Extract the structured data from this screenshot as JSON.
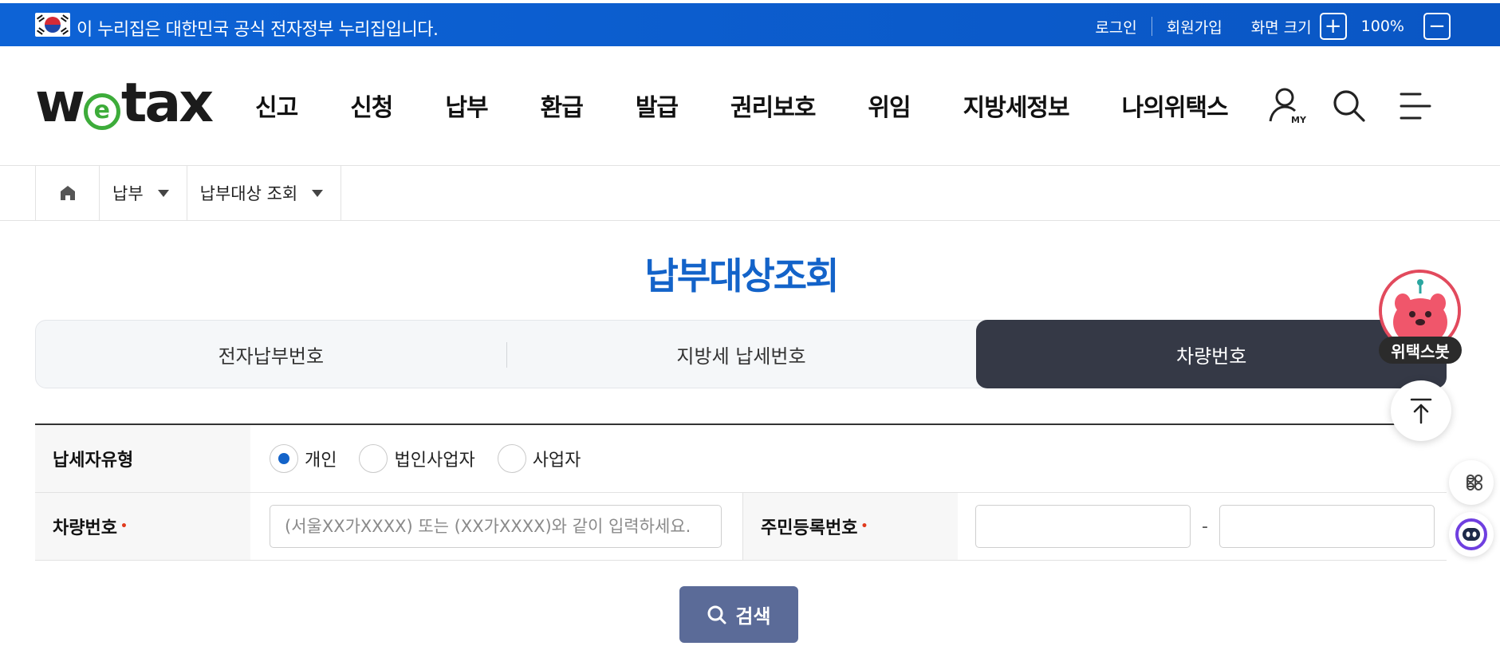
{
  "gov_banner": {
    "text": "이 누리집은 대한민국 공식 전자정부 누리집입니다.",
    "login": "로그인",
    "signup": "회원가입",
    "screen_size_label": "화면 크기",
    "zoom_in": "+",
    "zoom_level": "100%",
    "zoom_out": "−"
  },
  "header": {
    "logo_text_start": "w",
    "logo_text_e": "e",
    "logo_text_end": "tax",
    "nav": [
      "신고",
      "신청",
      "납부",
      "환급",
      "발급",
      "권리보호",
      "위임",
      "지방세정보",
      "나의위택스"
    ],
    "icons": [
      "my-page-icon",
      "search-icon",
      "menu-icon"
    ],
    "my_label": "MY"
  },
  "breadcrumb": {
    "level1": "납부",
    "level2": "납부대상 조회"
  },
  "page": {
    "title": "납부대상조회"
  },
  "tabs": [
    {
      "label": "전자납부번호",
      "active": false
    },
    {
      "label": "지방세 납세번호",
      "active": false
    },
    {
      "label": "차량번호",
      "active": true
    }
  ],
  "form": {
    "taxpayer_type_label": "납세자유형",
    "taxpayer_types": [
      "개인",
      "법인사업자",
      "사업자"
    ],
    "selected_type": "개인",
    "vehicle_label": "차량번호",
    "vehicle_placeholder": "(서울XX가XXXX) 또는 (XX가XXXX)와 같이 입력하세요.",
    "rrn_label": "주민등록번호",
    "rrn_dash": "-",
    "required_mark": "•"
  },
  "search_button": "검색",
  "floating": {
    "bot_label": "위택스봇"
  },
  "colors": {
    "gov_bar": "#0d63d6",
    "title_blue": "#1363c9",
    "tab_active": "#353946",
    "search_btn": "#5b6b98",
    "logo_green": "#3dac3a"
  }
}
